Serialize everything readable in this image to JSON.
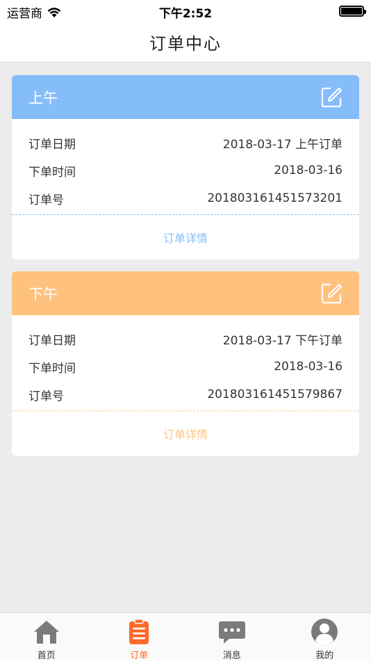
{
  "status_bar": {
    "carrier": "运营商",
    "time": "下午2:52"
  },
  "nav": {
    "title": "订单中心"
  },
  "orders": [
    {
      "header": "上午",
      "color": "#85bdfb",
      "rows": [
        {
          "label": "订单日期",
          "value": "2018-03-17 上午订单"
        },
        {
          "label": "下单时间",
          "value": "2018-03-16"
        },
        {
          "label": "订单号",
          "value": "201803161451573201"
        }
      ],
      "detail_label": "订单详情"
    },
    {
      "header": "下午",
      "color": "#ffc27e",
      "rows": [
        {
          "label": "订单日期",
          "value": "2018-03-17 下午订单"
        },
        {
          "label": "下单时间",
          "value": "2018-03-16"
        },
        {
          "label": "订单号",
          "value": "201803161451579867"
        }
      ],
      "detail_label": "订单详情"
    }
  ],
  "tabs": [
    {
      "label": "首页",
      "icon": "home-icon",
      "active": false
    },
    {
      "label": "订单",
      "icon": "clipboard-icon",
      "active": true
    },
    {
      "label": "消息",
      "icon": "chat-bubble-icon",
      "active": false
    },
    {
      "label": "我的",
      "icon": "user-avatar-icon",
      "active": false
    }
  ],
  "colors": {
    "accent": "#ff6a2c",
    "tab_inactive": "#7b7b7b"
  }
}
